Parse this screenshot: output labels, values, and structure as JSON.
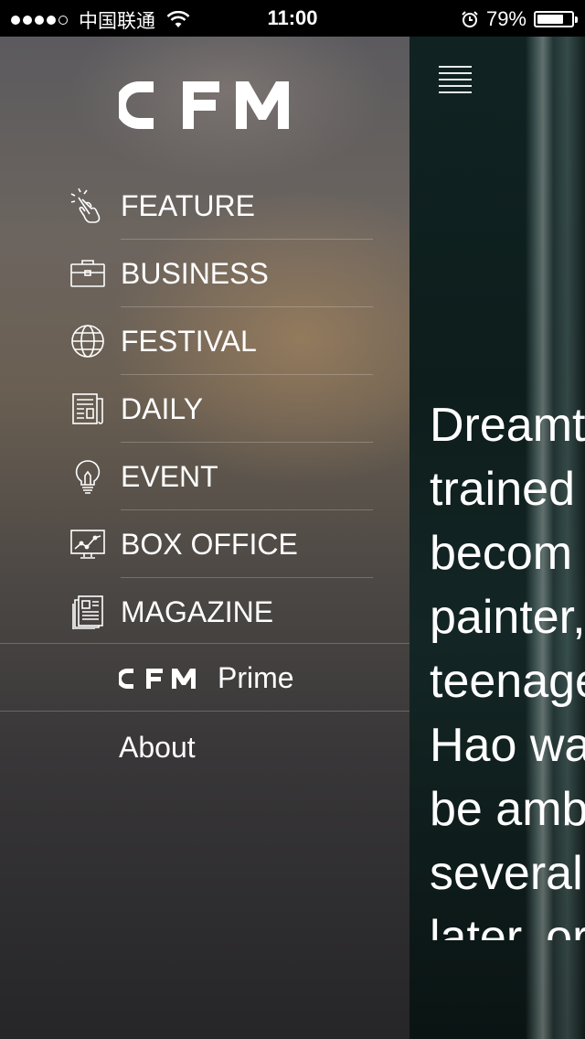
{
  "status_bar": {
    "carrier": "中国联通",
    "time": "11:00",
    "battery_percent": "79%",
    "battery_level": 0.79,
    "signal_filled": 4,
    "signal_total": 5
  },
  "drawer": {
    "logo_text": "CFM",
    "items": [
      {
        "label": "FEATURE",
        "icon": "tap-hand-icon"
      },
      {
        "label": "BUSINESS",
        "icon": "briefcase-icon"
      },
      {
        "label": "FESTIVAL",
        "icon": "globe-icon"
      },
      {
        "label": "DAILY",
        "icon": "newspaper-icon"
      },
      {
        "label": "EVENT",
        "icon": "lightbulb-icon"
      },
      {
        "label": "BOX OFFICE",
        "icon": "chart-monitor-icon"
      },
      {
        "label": "MAGAZINE",
        "icon": "magazine-icon"
      }
    ],
    "prime": {
      "logo_text": "CFM",
      "label": "Prime"
    },
    "about": "About"
  },
  "content": {
    "menu_icon": "hamburger-menu-icon",
    "lines": [
      "Dreamt",
      "trained",
      "becom",
      "painter,",
      "teenage",
      "Hao wa",
      "be amb",
      "several",
      "later, or"
    ]
  },
  "colors": {
    "text": "#ffffff",
    "separator": "rgba(255,255,255,0.22)",
    "content_bg": "#102322"
  }
}
